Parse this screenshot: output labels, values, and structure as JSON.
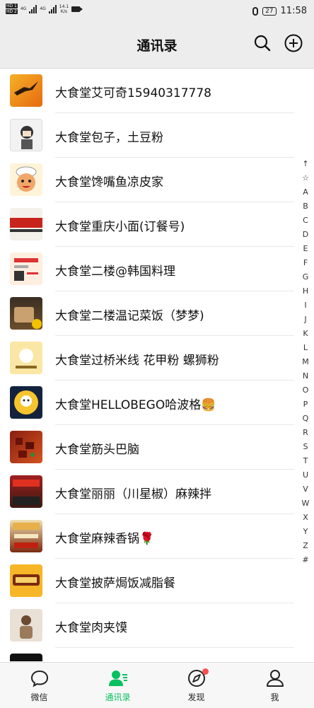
{
  "status_bar": {
    "hd1": "HD 1",
    "hd2": "HD 2",
    "net1": "4G",
    "net2": "4G",
    "speed_value": "14.1",
    "speed_unit": "K/s",
    "battery": "27",
    "time": "11:58"
  },
  "header": {
    "title": "通讯录"
  },
  "contacts": [
    "大食堂艾可奇15940317778",
    "大食堂包子，土豆粉",
    "大食堂馋嘴鱼凉皮家",
    "大食堂重庆小面(订餐号)",
    "大食堂二楼@韩国料理",
    "大食堂二楼温记菜饭（梦梦)",
    "大食堂过桥米线 花甲粉 螺狮粉",
    "大食堂HELLOBEGO哈波格🍔",
    "大食堂筋头巴脑",
    "大食堂丽丽（川星椒）麻辣拌",
    "大食堂麻辣香锅🌹",
    "大食堂披萨焗饭减脂餐",
    "大食堂肉夹馍",
    ""
  ],
  "alpha_index": [
    "↑",
    "☆",
    "A",
    "B",
    "C",
    "D",
    "E",
    "F",
    "G",
    "H",
    "I",
    "J",
    "K",
    "L",
    "M",
    "N",
    "O",
    "P",
    "Q",
    "R",
    "S",
    "T",
    "U",
    "V",
    "W",
    "X",
    "Y",
    "Z",
    "#"
  ],
  "tabbar": {
    "chats": "微信",
    "contacts": "通讯录",
    "discover": "发现",
    "me": "我"
  },
  "colors": {
    "active": "#07c160",
    "badge": "#fa5151",
    "header_bg": "#ededed"
  }
}
